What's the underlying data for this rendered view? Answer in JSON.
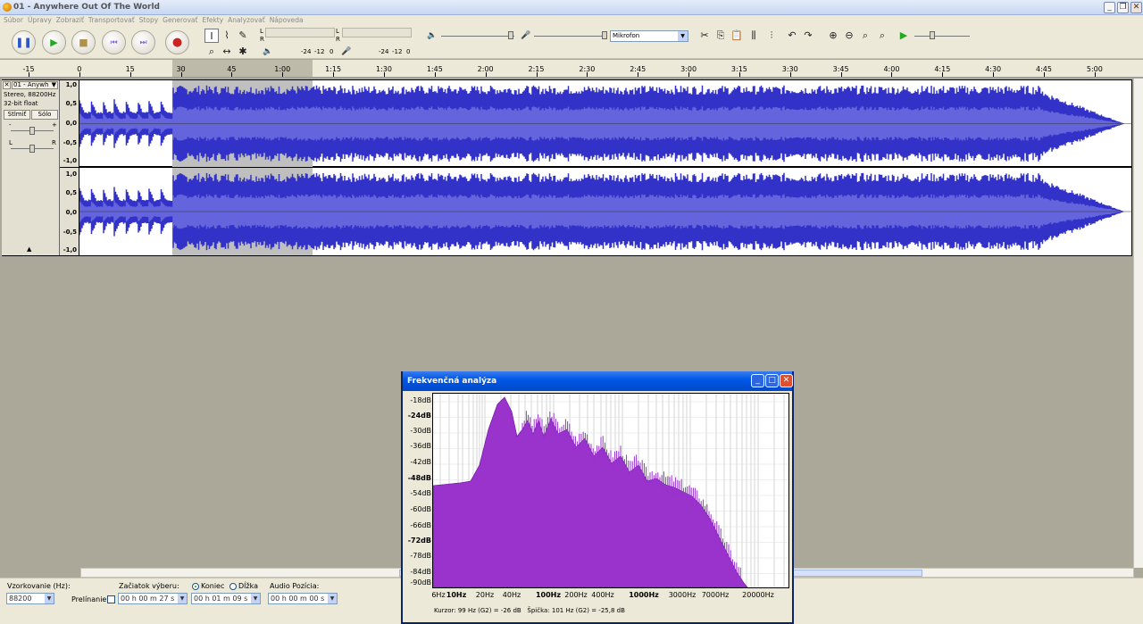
{
  "window": {
    "title": "01 - Anywhere Out Of The World"
  },
  "menu": [
    "Súbor",
    "Úpravy",
    "Zobraziť",
    "Transportovať",
    "Stopy",
    "Generovať",
    "Efekty",
    "Analyzovať",
    "Nápoveda"
  ],
  "meters": {
    "l": "L",
    "r": "R",
    "db1": "-24",
    "db2": "-12",
    "db3": "0"
  },
  "mixer": {
    "input_source": "Mikrofon"
  },
  "ruler": {
    "ticks": [
      "-15",
      "0",
      "15",
      "30",
      "45",
      "1:00",
      "1:15",
      "1:30",
      "1:45",
      "2:00",
      "2:15",
      "2:30",
      "2:45",
      "3:00",
      "3:15",
      "3:30",
      "3:45",
      "4:00",
      "4:15",
      "4:30",
      "4:45",
      "5:00"
    ]
  },
  "track": {
    "name": "01 - Anywh",
    "format": "Stereo, 88200Hz",
    "bits": "32-bit float",
    "mute": "Stlmiť",
    "solo": "Sólo",
    "gain_minus": "-",
    "gain_plus": "+",
    "pan_l": "L",
    "pan_r": "R",
    "scale": [
      "1,0",
      "0,5",
      "0,0",
      "-0,5",
      "-1,0"
    ]
  },
  "status": {
    "rate_label": "Vzorkovanie (Hz):",
    "rate_value": "88200",
    "overlap_label": "Prelínanie",
    "sel_start_label": "Začiatok výberu:",
    "end_label": "Koniec",
    "length_label": "Dĺžka",
    "audio_pos_label": "Audio Pozícia:",
    "sel_start": "00 h 00 m 27 s",
    "sel_end": "00 h 01 m 09 s",
    "audio_pos": "00 h 00 m 00 s"
  },
  "dialog": {
    "title": "Frekvenčná analýza",
    "ylabels": [
      "-18dB",
      "-24dB",
      "-30dB",
      "-36dB",
      "-42dB",
      "-48dB",
      "-54dB",
      "-60dB",
      "-66dB",
      "-72dB",
      "-78dB",
      "-84dB",
      "-90dB"
    ],
    "xlabels": [
      "6Hz",
      "10Hz",
      "20Hz",
      "40Hz",
      "100Hz",
      "200Hz",
      "400Hz",
      "1000Hz",
      "3000Hz",
      "7000Hz",
      "20000Hz"
    ],
    "cursor_text": "Kurzor: 99 Hz (G2) = -26 dB",
    "peak_text": "Špička: 101 Hz (G2) = -25,8 dB"
  },
  "colors": {
    "wave": "#3232c8",
    "wave_inner": "#6464dc",
    "spectrum": "#9933cc"
  }
}
